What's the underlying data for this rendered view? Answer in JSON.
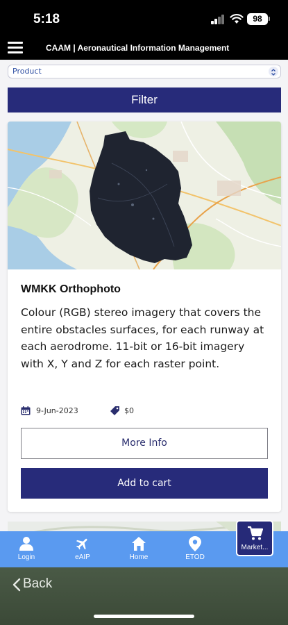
{
  "status_bar": {
    "time": "5:18",
    "battery": "98"
  },
  "header": {
    "title": "CAAM | Aeronautical Information Management",
    "menu_icon": "hamburger-menu-icon"
  },
  "filters": {
    "product_select_value": "Product",
    "filter_button_label": "Filter"
  },
  "product_card": {
    "title": "WMKK Orthophoto",
    "description": "Colour (RGB) stereo imagery that covers the entire obstacles surfaces, for each runway at each aerodrome. 11-bit or 16-bit imagery with X, Y and Z for each raster point.",
    "date": "9-Jun-2023",
    "price": "$0",
    "more_info_label": "More Info",
    "add_to_cart_label": "Add to cart",
    "image_icon": "orthophoto-map-image"
  },
  "bottom_nav": {
    "items": [
      {
        "label": "Login",
        "icon": "user-icon"
      },
      {
        "label": "eAIP",
        "icon": "airplane-icon"
      },
      {
        "label": "Home",
        "icon": "home-icon"
      },
      {
        "label": "ETOD",
        "icon": "location-pin-icon"
      }
    ],
    "market_label": "Market...",
    "market_icon": "cart-icon"
  },
  "back_bar": {
    "label": "Back"
  },
  "colors": {
    "primary": "#272b7a",
    "nav_background": "#5a9af0",
    "header_background": "#000000"
  }
}
